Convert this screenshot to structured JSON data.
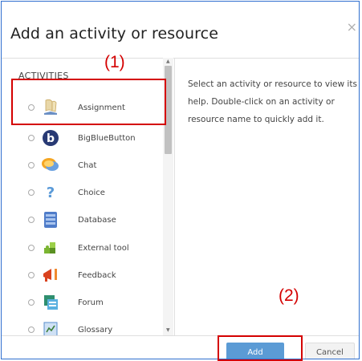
{
  "dialog": {
    "title": "Add an activity or resource",
    "close_glyph": "×"
  },
  "activities": {
    "section_label": "ACTIVITIES",
    "items": [
      {
        "label": "Assignment",
        "icon": "assignment-icon"
      },
      {
        "label": "BigBlueButton",
        "icon": "bigbluebutton-icon"
      },
      {
        "label": "Chat",
        "icon": "chat-icon"
      },
      {
        "label": "Choice",
        "icon": "choice-icon"
      },
      {
        "label": "Database",
        "icon": "database-icon"
      },
      {
        "label": "External tool",
        "icon": "external-tool-icon"
      },
      {
        "label": "Feedback",
        "icon": "feedback-icon"
      },
      {
        "label": "Forum",
        "icon": "forum-icon"
      },
      {
        "label": "Glossary",
        "icon": "glossary-icon"
      }
    ]
  },
  "help_text": "Select an activity or resource to view its help. Double-click on an activity or resource name to quickly add it.",
  "annotations": {
    "step1": "(1)",
    "step2": "(2)",
    "color": "#d40000"
  },
  "footer": {
    "add_label": "Add",
    "cancel_label": "Cancel"
  },
  "colors": {
    "accent": "#5b9bd5",
    "frame_border": "#2f6fcf"
  }
}
